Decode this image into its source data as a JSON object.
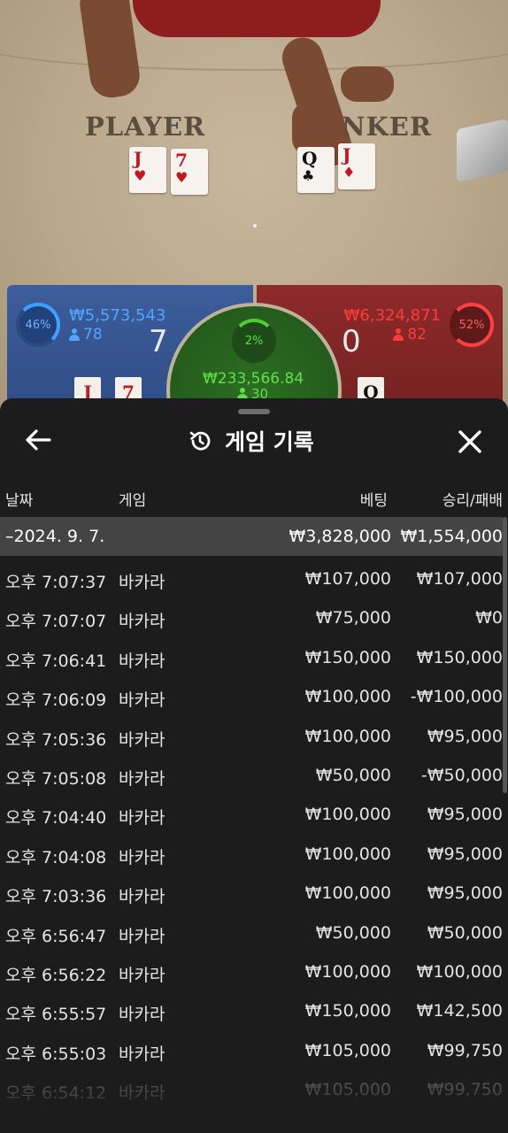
{
  "table": {
    "player_label": "PLAYER",
    "banker_label": "NKER",
    "player_cards": [
      {
        "rank": "J",
        "suit": "♥",
        "color": "red"
      },
      {
        "rank": "7",
        "suit": "♥",
        "color": "red"
      }
    ],
    "banker_cards": [
      {
        "rank": "Q",
        "suit": "♣",
        "color": "black"
      },
      {
        "rank": "J",
        "suit": "♦",
        "color": "red"
      }
    ]
  },
  "scoreboard": {
    "player": {
      "percent": "46%",
      "bet_total": "₩5,573,543",
      "bettors": "78",
      "score": "7",
      "cards": [
        "J",
        "7"
      ]
    },
    "banker": {
      "percent": "52%",
      "bet_total": "₩6,324,871",
      "bettors": "82",
      "score": "0",
      "cards": [
        "Q"
      ]
    },
    "tie": {
      "percent": "2%",
      "bet_total": "₩233,566.84",
      "bettors": "30"
    }
  },
  "history": {
    "title": "게임 기록",
    "back_icon": "arrow-left-icon",
    "history_icon": "history-icon",
    "close_icon": "close-icon",
    "columns": {
      "date": "날짜",
      "game": "게임",
      "bet": "베팅",
      "result": "승리/패배"
    },
    "day": {
      "label": "–2024. 9. 7.",
      "bet_total": "₩3,828,000",
      "result_total": "₩1,554,000"
    },
    "rows": [
      {
        "time": "오후 7:07:37",
        "game": "바카라",
        "bet": "₩107,000",
        "result": "₩107,000"
      },
      {
        "time": "오후 7:07:07",
        "game": "바카라",
        "bet": "₩75,000",
        "result": "₩0"
      },
      {
        "time": "오후 7:06:41",
        "game": "바카라",
        "bet": "₩150,000",
        "result": "₩150,000"
      },
      {
        "time": "오후 7:06:09",
        "game": "바카라",
        "bet": "₩100,000",
        "result": "-₩100,000"
      },
      {
        "time": "오후 7:05:36",
        "game": "바카라",
        "bet": "₩100,000",
        "result": "₩95,000"
      },
      {
        "time": "오후 7:05:08",
        "game": "바카라",
        "bet": "₩50,000",
        "result": "-₩50,000"
      },
      {
        "time": "오후 7:04:40",
        "game": "바카라",
        "bet": "₩100,000",
        "result": "₩95,000"
      },
      {
        "time": "오후 7:04:08",
        "game": "바카라",
        "bet": "₩100,000",
        "result": "₩95,000"
      },
      {
        "time": "오후 7:03:36",
        "game": "바카라",
        "bet": "₩100,000",
        "result": "₩95,000"
      },
      {
        "time": "오후 6:56:47",
        "game": "바카라",
        "bet": "₩50,000",
        "result": "₩50,000"
      },
      {
        "time": "오후 6:56:22",
        "game": "바카라",
        "bet": "₩100,000",
        "result": "₩100,000"
      },
      {
        "time": "오후 6:55:57",
        "game": "바카라",
        "bet": "₩150,000",
        "result": "₩142,500"
      },
      {
        "time": "오후 6:55:03",
        "game": "바카라",
        "bet": "₩105,000",
        "result": "₩99,750"
      },
      {
        "time": "오후 6:54:12",
        "game": "바카라",
        "bet": "₩105,000",
        "result": "₩99,750"
      }
    ]
  }
}
